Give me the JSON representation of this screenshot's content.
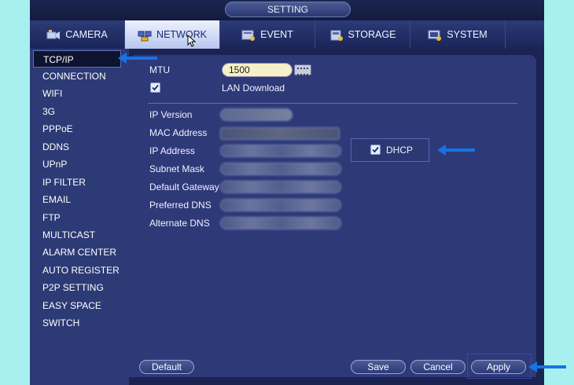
{
  "window": {
    "title": "SETTING"
  },
  "tabs": [
    {
      "label": "CAMERA",
      "icon": "camera-icon"
    },
    {
      "label": "NETWORK",
      "icon": "network-icon",
      "active": true
    },
    {
      "label": "EVENT",
      "icon": "event-icon"
    },
    {
      "label": "STORAGE",
      "icon": "storage-icon"
    },
    {
      "label": "SYSTEM",
      "icon": "system-icon"
    }
  ],
  "sidebar": {
    "items": [
      {
        "label": "TCP/IP",
        "active": true
      },
      {
        "label": "CONNECTION"
      },
      {
        "label": "WIFI"
      },
      {
        "label": "3G"
      },
      {
        "label": "PPPoE"
      },
      {
        "label": "DDNS"
      },
      {
        "label": "UPnP"
      },
      {
        "label": "IP FILTER"
      },
      {
        "label": "EMAIL"
      },
      {
        "label": "FTP"
      },
      {
        "label": "MULTICAST"
      },
      {
        "label": "ALARM CENTER"
      },
      {
        "label": "AUTO REGISTER"
      },
      {
        "label": "P2P SETTING"
      },
      {
        "label": "EASY SPACE"
      },
      {
        "label": "SWITCH"
      }
    ]
  },
  "form": {
    "mtu_label": "MTU",
    "mtu_value": "1500",
    "lan_download_label": "LAN Download",
    "lan_download_checked": true,
    "ip_version_label": "IP Version",
    "mac_address_label": "MAC Address",
    "ip_address_label": "IP Address",
    "subnet_mask_label": "Subnet Mask",
    "default_gateway_label": "Default Gateway",
    "preferred_dns_label": "Preferred DNS",
    "alternate_dns_label": "Alternate DNS",
    "dhcp_label": "DHCP",
    "dhcp_checked": true
  },
  "buttons": {
    "default": "Default",
    "save": "Save",
    "cancel": "Cancel",
    "apply": "Apply"
  },
  "colors": {
    "arrow": "#1673e6",
    "background": "#a8f0ef",
    "panel": "#2e3978"
  }
}
